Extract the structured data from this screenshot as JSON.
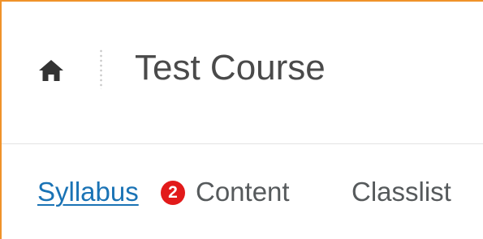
{
  "header": {
    "home_icon": "home-icon",
    "course_title": "Test Course"
  },
  "nav": {
    "items": [
      {
        "label": "Syllabus",
        "active": true
      },
      {
        "label": "Content",
        "badge": "2"
      },
      {
        "label": "Classlist"
      }
    ]
  },
  "colors": {
    "frame_border": "#f0922a",
    "link": "#1a73b5",
    "badge": "#e21a1a",
    "text": "#4a4a4a"
  }
}
